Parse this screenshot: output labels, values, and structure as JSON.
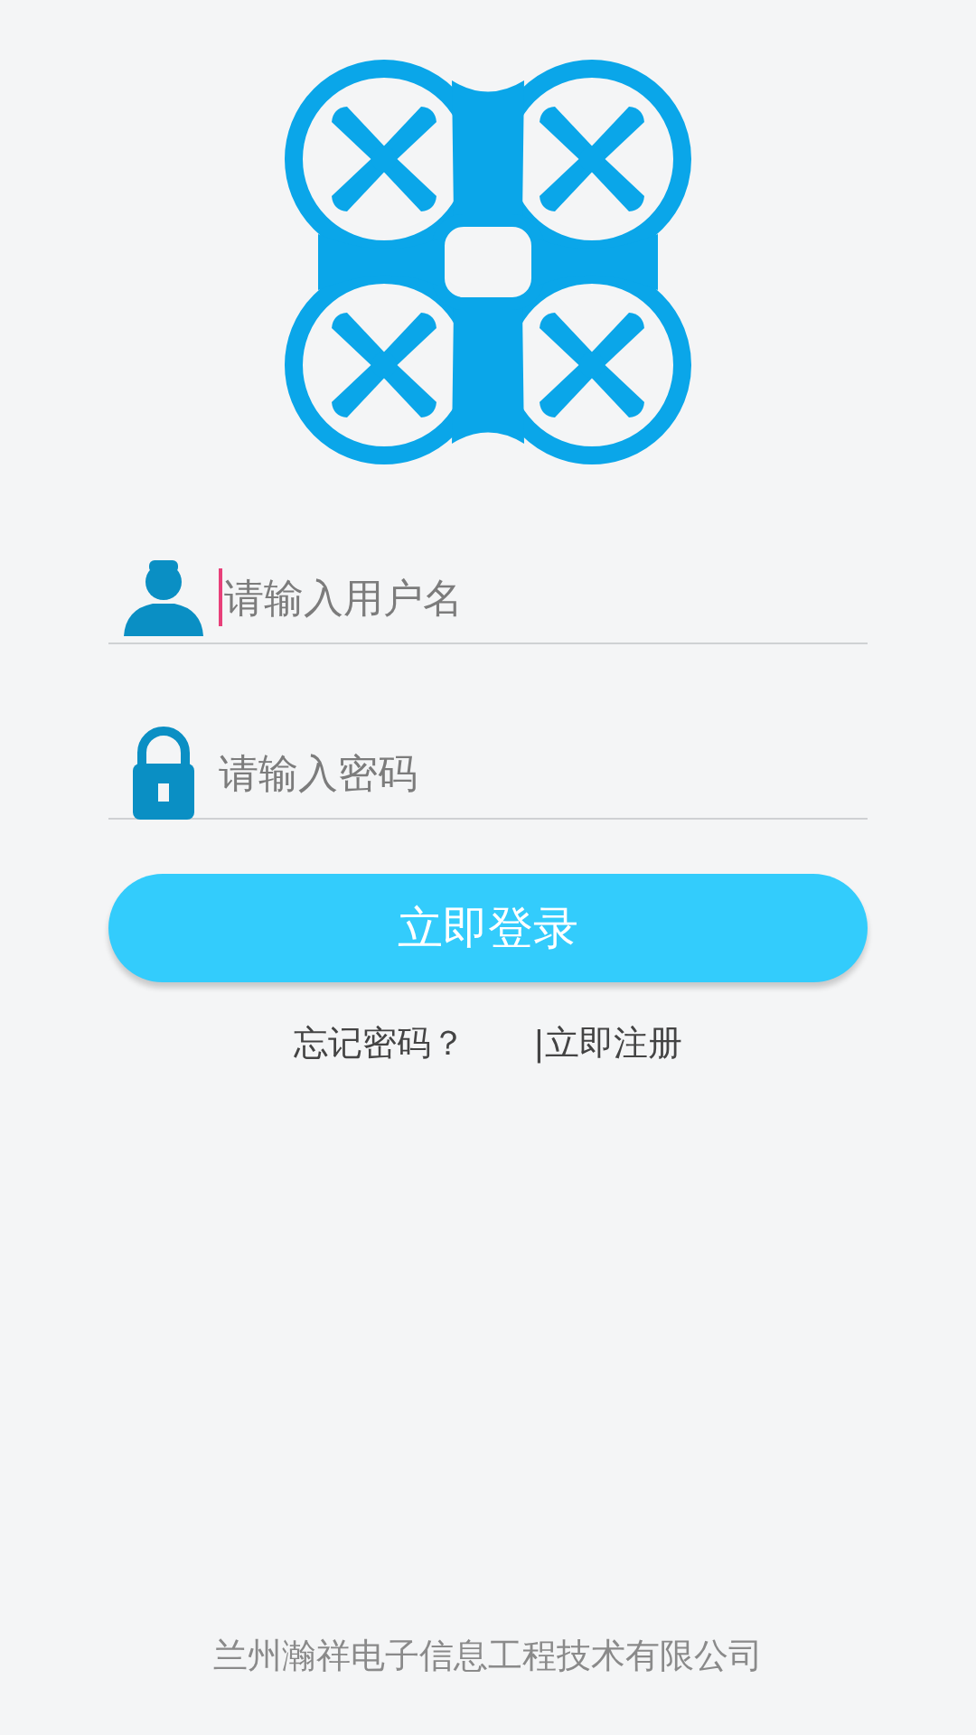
{
  "fields": [
    {
      "kind": "user",
      "placeholder": "请输入用户名",
      "focused": true
    },
    {
      "kind": "password",
      "placeholder": "请输入密码",
      "focused": false
    }
  ],
  "login_button": "立即登录",
  "links": [
    "忘记密码？",
    "|立即注册"
  ],
  "footer": "兰州瀚祥电子信息工程技术有限公司"
}
